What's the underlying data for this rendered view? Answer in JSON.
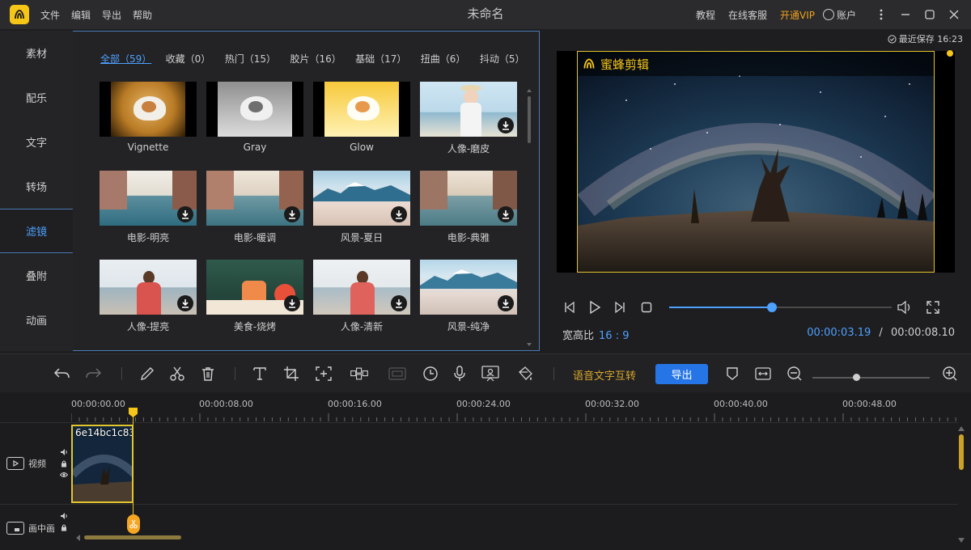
{
  "titlebar": {
    "menu": [
      "文件",
      "编辑",
      "导出",
      "帮助"
    ],
    "title": "未命名",
    "right_links": [
      "教程",
      "在线客服"
    ],
    "vip": "开通VIP",
    "account": "账户"
  },
  "leftnav": {
    "items": [
      "素材",
      "配乐",
      "文字",
      "转场",
      "滤镜",
      "叠附",
      "动画"
    ],
    "active_index": 4
  },
  "filters": {
    "categories": [
      "全部（59）",
      "收藏（0）",
      "热门（15）",
      "胶片（16）",
      "基础（17）",
      "扭曲（6）",
      "抖动（5）"
    ],
    "items": [
      {
        "label": "Vignette",
        "icon": "cat-photo",
        "download": false
      },
      {
        "label": "Gray",
        "icon": "cat-photo",
        "download": false
      },
      {
        "label": "Glow",
        "icon": "cat-photo",
        "download": false
      },
      {
        "label": "人像-磨皮",
        "icon": "portrait-photo",
        "download": true
      },
      {
        "label": "电影-明亮",
        "icon": "street-photo",
        "download": true
      },
      {
        "label": "电影-暖调",
        "icon": "street-photo",
        "download": true
      },
      {
        "label": "风景-夏日",
        "icon": "mountain-photo",
        "download": true
      },
      {
        "label": "电影-典雅",
        "icon": "street-photo",
        "download": true
      },
      {
        "label": "人像-提亮",
        "icon": "beach-portrait-photo",
        "download": true
      },
      {
        "label": "美食-烧烤",
        "icon": "food-photo",
        "download": true
      },
      {
        "label": "人像-清新",
        "icon": "beach-portrait-photo",
        "download": true
      },
      {
        "label": "风景-纯净",
        "icon": "mountain-photo",
        "download": true
      }
    ]
  },
  "preview": {
    "saved": "最近保存 16:23",
    "watermark": "蜜蜂剪辑",
    "aspect_label": "宽高比",
    "aspect_value": "16 : 9",
    "current_time": "00:00:03.19",
    "separator": "/",
    "total_time": "00:00:08.10",
    "progress": 0.46
  },
  "toolbar": {
    "voice_text": "语音文字互转",
    "export": "导出",
    "zoom_level": 0.37
  },
  "timeline": {
    "ruler_labels": [
      "00:00:00.00",
      "00:00:08.00",
      "00:00:16.00",
      "00:00:24.00",
      "00:00:32.00",
      "00:00:40.00",
      "00:00:48.00"
    ],
    "tracks": [
      "视频",
      "画中画"
    ],
    "clip_name": "6e14bc1c83"
  },
  "colors": {
    "accent": "#4ea1ff",
    "highlight": "#e2c52d",
    "vip": "#f0a21c",
    "export_button": "#2575e6"
  }
}
